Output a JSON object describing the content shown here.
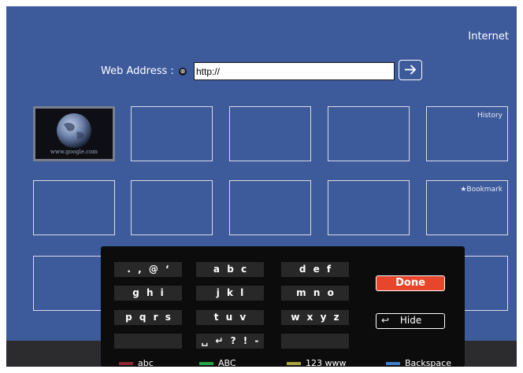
{
  "app": {
    "title": "Internet"
  },
  "address_bar": {
    "label": "Web Address :",
    "clear_icon": "⊗",
    "value": "http://"
  },
  "tiles": {
    "thumb_caption": "www.google.com",
    "history_label": "History",
    "bookmark_label": "★Bookmark"
  },
  "keyboard": {
    "rows": [
      {
        "keys": [
          ". , @ ‘",
          "a  b  c",
          "d  e  f"
        ]
      },
      {
        "keys": [
          "g  h  i",
          "j  k  l",
          "m  n  o"
        ]
      },
      {
        "keys": [
          "p q r s",
          "t  u  v",
          "w  x  y  z"
        ]
      },
      {
        "keys": [
          "",
          "␣ ↵ ? ! -",
          ""
        ]
      }
    ],
    "done_label": "Done",
    "hide_label": "Hide",
    "hide_icon": "↩"
  },
  "color_hints": [
    {
      "label": "abc",
      "color": "#8b2a34"
    },
    {
      "label": "ABC",
      "color": "#27a148"
    },
    {
      "label": "123 www",
      "color": "#a7a33d"
    },
    {
      "label": "Backspace",
      "color": "#3b7ec9"
    }
  ]
}
